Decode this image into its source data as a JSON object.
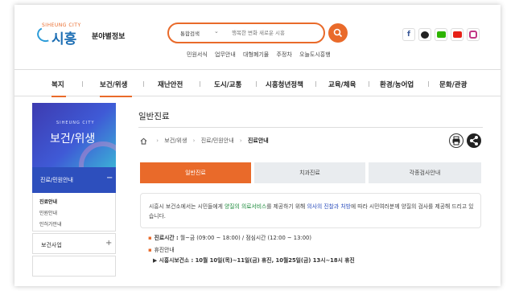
{
  "header": {
    "logo_small": "SIHEUNG CITY",
    "logo_name": "시흥",
    "site_sub": "분야별정보",
    "search": {
      "category": "통합검색",
      "placeholder": "행복한 변화 새로운 시흥"
    },
    "quick_links": [
      "민원서식",
      "업무안내",
      "대형폐기물",
      "주정차",
      "오늘도시흥행"
    ]
  },
  "social": [
    "facebook-icon",
    "kakaotalk-icon",
    "band-icon",
    "youtube-icon",
    "instagram-icon"
  ],
  "gnb": [
    "복지",
    "보건/위생",
    "재난안전",
    "도시/교통",
    "시흥청년정책",
    "교육/체육",
    "환경/농어업",
    "문화/관광"
  ],
  "sidebar": {
    "banner_small": "SIHEUNG CITY",
    "banner_title": "보건/위생",
    "active_menu": "진료/민원안내",
    "sub_items": [
      "진료안내",
      "민원안내",
      "인허가안내"
    ],
    "menu2": "보건사업"
  },
  "content": {
    "title": "일반진료",
    "breadcrumb": [
      "보건/위생",
      "진료/민원안내",
      "진료안내"
    ],
    "tabs": [
      "일반진료",
      "치과진료",
      "각종검사안내"
    ],
    "info": {
      "part1": "시흥시 보건소에서는 시민들에게 ",
      "hl1": "양질의 의료서비스",
      "part2": "를 제공하기 위해 ",
      "hl2": "의사의 진찰과 처방",
      "part3": "에 따라 시민여러분께 양질의 검사를 제공해 드리고 있습니다."
    },
    "hours_label": "진료시간 :",
    "hours_value": "월~금 (09:00 ~ 18:00) / 점심시간 (12:00 ~ 13:00)",
    "closed_label": "휴진안내",
    "closed_detail": "▶ 시흥시보건소 : 10월 10일(목)~11일(금) 휴진, 10월25일(금) 13시~18시 휴진"
  }
}
